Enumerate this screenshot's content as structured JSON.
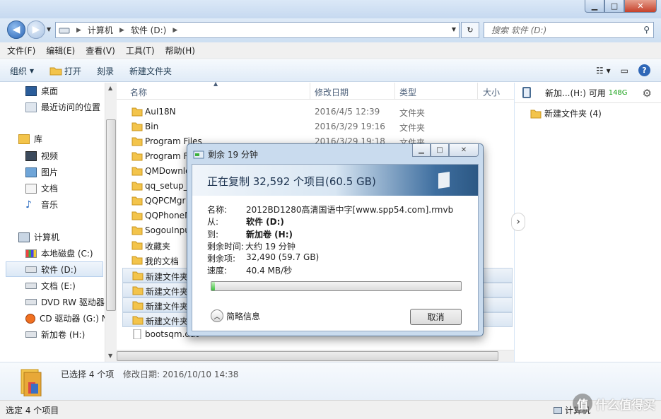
{
  "window": {
    "min_icon": "minimize-icon",
    "max_icon": "maximize-icon",
    "close_icon": "close-icon"
  },
  "address": {
    "crumbs": [
      "计算机",
      "软件 (D:)"
    ]
  },
  "search": {
    "placeholder": "搜索 软件 (D:)"
  },
  "menu": [
    "文件(F)",
    "编辑(E)",
    "查看(V)",
    "工具(T)",
    "帮助(H)"
  ],
  "toolbar": {
    "organize": "组织",
    "open": "打开",
    "burn": "刻录",
    "new_folder": "新建文件夹"
  },
  "nav": {
    "desktop": "桌面",
    "recent": "最近访问的位置",
    "library": "库",
    "video": "视频",
    "pictures": "图片",
    "docs": "文档",
    "music": "音乐",
    "computer": "计算机",
    "drive_c": "本地磁盘 (C:)",
    "drive_d": "软件 (D:)",
    "drive_e": "文档 (E:)",
    "drive_dvd": "DVD RW 驱动器",
    "drive_cd": "CD 驱动器 (G:) N",
    "drive_h": "新加卷 (H:)"
  },
  "columns": {
    "name": "名称",
    "date": "修改日期",
    "type": "类型",
    "size": "大小"
  },
  "files": [
    {
      "name": "AuI18N",
      "date": "2016/4/5 12:39",
      "type": "文件夹",
      "selected": false
    },
    {
      "name": "Bin",
      "date": "2016/3/29 19:16",
      "type": "文件夹",
      "selected": false
    },
    {
      "name": "Program Files",
      "date": "2016/3/29 19:18",
      "type": "文件夹",
      "selected": false
    },
    {
      "name": "Program F",
      "date": "",
      "type": "",
      "selected": false
    },
    {
      "name": "QMDownlo",
      "date": "",
      "type": "",
      "selected": false
    },
    {
      "name": "qq_setup_1",
      "date": "",
      "type": "",
      "selected": false
    },
    {
      "name": "QQPCMgr",
      "date": "",
      "type": "",
      "selected": false
    },
    {
      "name": "QQPhoneM",
      "date": "",
      "type": "",
      "selected": false
    },
    {
      "name": "SogouInpu",
      "date": "",
      "type": "",
      "selected": false
    },
    {
      "name": "收藏夹",
      "date": "",
      "type": "",
      "selected": false
    },
    {
      "name": "我的文档",
      "date": "",
      "type": "",
      "selected": false
    },
    {
      "name": "新建文件夹",
      "date": "",
      "type": "",
      "selected": true
    },
    {
      "name": "新建文件夹",
      "date": "",
      "type": "",
      "selected": true
    },
    {
      "name": "新建文件夹",
      "date": "",
      "type": "",
      "selected": true
    },
    {
      "name": "新建文件夹",
      "date": "",
      "type": "",
      "selected": true
    },
    {
      "name": "bootsqm.dat",
      "date": "",
      "type": "",
      "selected": false
    }
  ],
  "right": {
    "drive": "新加...(H:) 可用",
    "free": "148G",
    "folder": "新建文件夹 (4)"
  },
  "details": {
    "selected": "已选择 4 个项",
    "modified": "修改日期: 2016/10/10 14:38"
  },
  "status": {
    "text": "选定 4 个项目",
    "computer": "计算机"
  },
  "watermark": {
    "text": "什么值得买",
    "logo": "值"
  },
  "dialog": {
    "title": "剩余 19 分钟",
    "heading": "正在复制 32,592 个项目(60.5 GB)",
    "name_label": "名称:",
    "name_value": "2012BD1280高清国语中字[www.spp54.com].rmvb",
    "from_label": "从:",
    "from_value": "软件 (D:)",
    "to_label": "到:",
    "to_value": "新加卷 (H:)",
    "remaining_time_label": "剩余时间:",
    "remaining_time_value": "大约 19 分钟",
    "remaining_items_label": "剩余项:",
    "remaining_items_value": "32,490 (59.7 GB)",
    "speed_label": "速度:",
    "speed_value": "40.4 MB/秒",
    "progress": 0.013,
    "details_label": "简略信息",
    "cancel_label": "取消"
  }
}
